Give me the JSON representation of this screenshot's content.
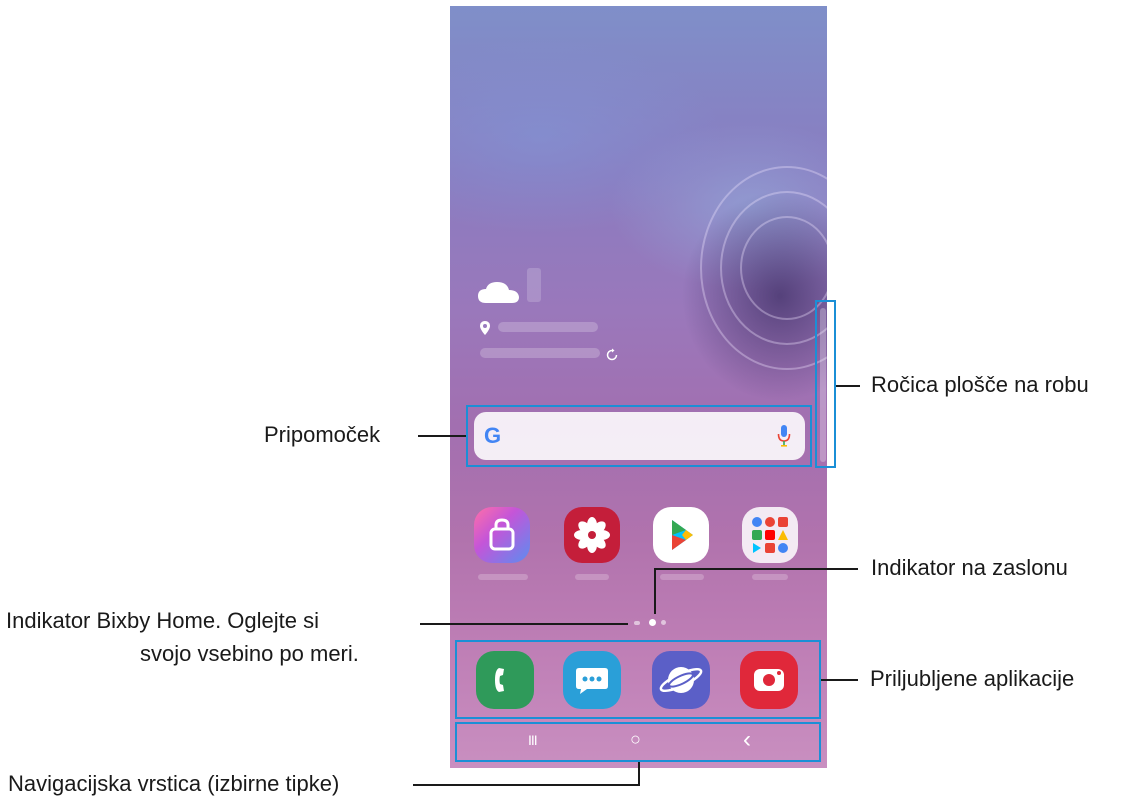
{
  "callouts": {
    "widget": "Pripomoček",
    "edge_panel_handle": "Ročica plošče na robu",
    "screen_indicator": "Indikator na zaslonu",
    "bixby_line1": "Indikator Bixby Home. Oglejte si",
    "bixby_line2": "svojo vsebino po meri.",
    "favorite_apps": "Priljubljene aplikacije",
    "navigation_bar": "Navigacijska vrstica (izbirne tipke)"
  },
  "colors": {
    "highlight": "#1b8fd6",
    "phone_app": "#2f9a5a",
    "messages_app": "#2a9fd8",
    "internet_app": "#5b5fc7",
    "camera_app": "#e0283a",
    "gallery_app": "#c41e3a"
  },
  "icons": {
    "weather": "cloud-icon",
    "location": "pin-icon",
    "refresh": "refresh-icon",
    "search_engine": "google-g-icon",
    "voice": "mic-icon",
    "nav_recents": "recents-icon",
    "nav_home": "home-icon",
    "nav_back": "back-icon"
  },
  "home_apps": [
    "galaxy-store-icon",
    "gallery-icon",
    "play-store-icon",
    "google-folder-icon"
  ],
  "dock_apps": [
    "phone-icon",
    "messages-icon",
    "internet-icon",
    "camera-icon"
  ],
  "nav": {
    "recents": "III",
    "home": "○",
    "back": "‹"
  },
  "search": {
    "logo": "G"
  }
}
